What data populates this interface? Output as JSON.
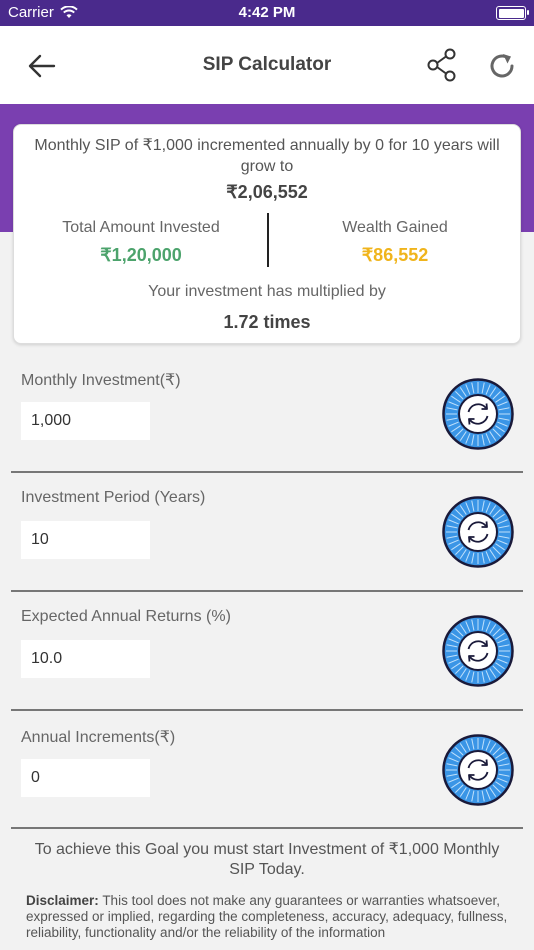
{
  "status_bar": {
    "carrier": "Carrier",
    "time": "4:42 PM"
  },
  "header": {
    "title": "SIP Calculator"
  },
  "summary": {
    "headline": "Monthly SIP of ₹1,000 incremented annually by 0 for 10 years will grow to",
    "total_value": "₹2,06,552",
    "invested_label": "Total Amount Invested",
    "invested_value": "₹1,20,000",
    "gained_label": "Wealth Gained",
    "gained_value": "₹86,552",
    "multiplied_label": "Your investment has multiplied by",
    "multiplied_value": "1.72 times"
  },
  "fields": {
    "monthly": {
      "label": "Monthly Investment(₹)",
      "value": "1,000"
    },
    "period": {
      "label": "Investment Period (Years)",
      "value": "10"
    },
    "returns": {
      "label": "Expected Annual Returns (%)",
      "value": "10.0"
    },
    "increments": {
      "label": "Annual Increments(₹)",
      "value": "0"
    }
  },
  "goal_text": "To achieve this Goal you must start Investment of ₹1,000 Monthly SIP Today.",
  "disclaimer": {
    "title": "Disclaimer:",
    "body": "This tool does not make any guarantees or warranties whatsoever, expressed or implied, regarding the completeness, accuracy, adequacy, fullness, reliability, functionality and/or the reliability of the information"
  },
  "colors": {
    "status_bar": "#4a2a8c",
    "band": "#7a3fb0",
    "invested": "#4ca36c",
    "gained": "#f0b41c",
    "dial": "#3a95e6"
  },
  "icons": [
    "back-arrow-icon",
    "share-icon",
    "refresh-icon",
    "wifi-icon",
    "battery-icon",
    "dial-icon"
  ]
}
